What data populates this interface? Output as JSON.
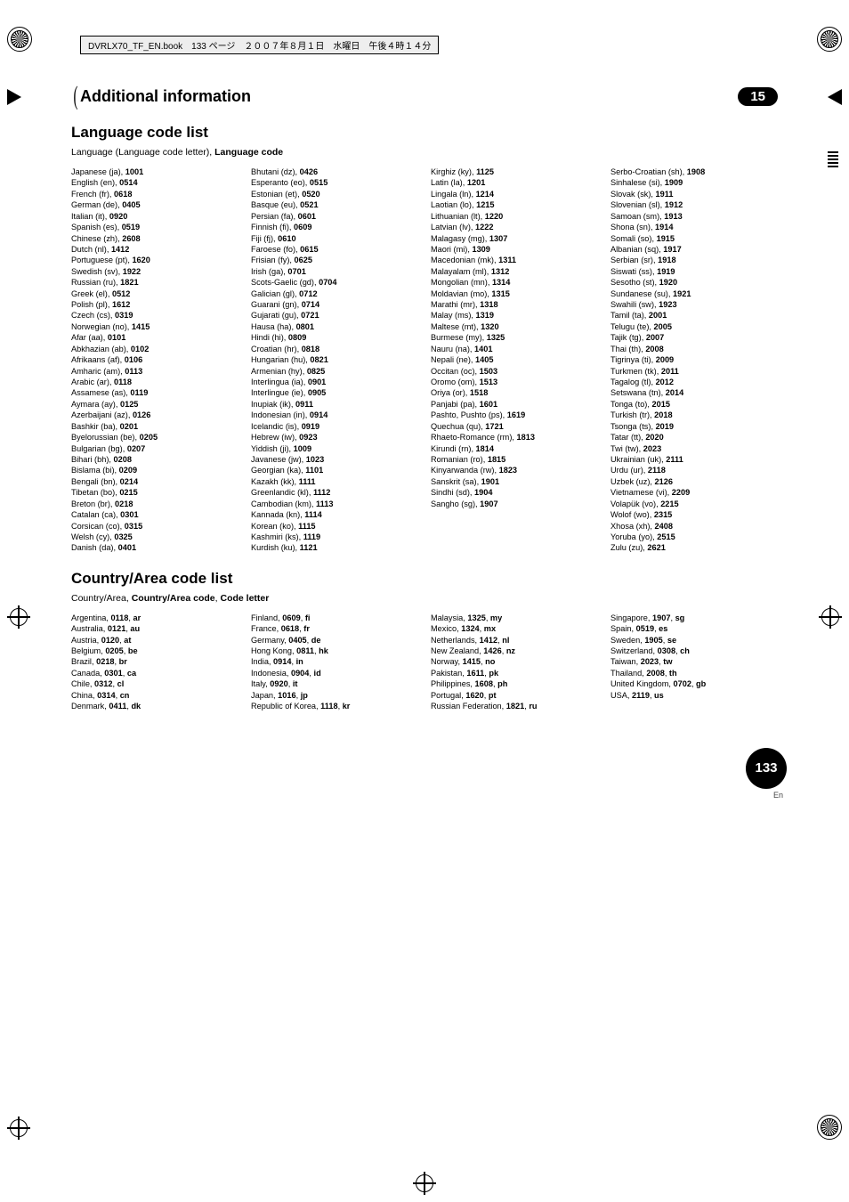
{
  "header_box": "DVRLX70_TF_EN.book　133 ページ　２００７年８月１日　水曜日　午後４時１４分",
  "section_title": "Additional information",
  "section_badge": "15",
  "lang_heading": "Language code list",
  "lang_sub_prefix": "Language (Language code letter), ",
  "lang_sub_bold": "Language code",
  "lang_cols": [
    [
      [
        "Japanese (ja), ",
        "1001"
      ],
      [
        "English (en), ",
        "0514"
      ],
      [
        "French (fr), ",
        "0618"
      ],
      [
        "German (de), ",
        "0405"
      ],
      [
        "Italian (it), ",
        "0920"
      ],
      [
        "Spanish (es), ",
        "0519"
      ],
      [
        "Chinese (zh), ",
        "2608"
      ],
      [
        "Dutch (nl), ",
        "1412"
      ],
      [
        "Portuguese (pt), ",
        "1620"
      ],
      [
        "Swedish (sv), ",
        "1922"
      ],
      [
        "Russian (ru), ",
        "1821"
      ],
      [
        "Greek (el), ",
        "0512"
      ],
      [
        "Polish (pl), ",
        "1612"
      ],
      [
        "Czech (cs), ",
        "0319"
      ],
      [
        "Norwegian (no), ",
        "1415"
      ],
      [
        "Afar (aa), ",
        "0101"
      ],
      [
        "Abkhazian (ab), ",
        "0102"
      ],
      [
        "Afrikaans (af), ",
        "0106"
      ],
      [
        "Amharic (am), ",
        "0113"
      ],
      [
        "Arabic (ar), ",
        "0118"
      ],
      [
        "Assamese (as), ",
        "0119"
      ],
      [
        "Aymara (ay), ",
        "0125"
      ],
      [
        "Azerbaijani (az), ",
        "0126"
      ],
      [
        "Bashkir (ba), ",
        "0201"
      ],
      [
        "Byelorussian (be), ",
        "0205"
      ],
      [
        "Bulgarian (bg), ",
        "0207"
      ],
      [
        "Bihari (bh), ",
        "0208"
      ],
      [
        "Bislama (bi), ",
        "0209"
      ],
      [
        "Bengali (bn), ",
        "0214"
      ],
      [
        "Tibetan (bo), ",
        "0215"
      ],
      [
        "Breton (br), ",
        "0218"
      ],
      [
        "Catalan (ca), ",
        "0301"
      ],
      [
        "Corsican (co), ",
        "0315"
      ],
      [
        "Welsh (cy), ",
        "0325"
      ],
      [
        "Danish (da), ",
        "0401"
      ]
    ],
    [
      [
        "Bhutani (dz), ",
        "0426"
      ],
      [
        "Esperanto (eo), ",
        "0515"
      ],
      [
        "Estonian (et), ",
        "0520"
      ],
      [
        "Basque (eu), ",
        "0521"
      ],
      [
        "Persian (fa), ",
        "0601"
      ],
      [
        "Finnish (fi), ",
        "0609"
      ],
      [
        "Fiji (fj), ",
        "0610"
      ],
      [
        "Faroese (fo), ",
        "0615"
      ],
      [
        "Frisian (fy), ",
        "0625"
      ],
      [
        "Irish (ga), ",
        "0701"
      ],
      [
        "Scots-Gaelic (gd), ",
        "0704"
      ],
      [
        "Galician (gl), ",
        "0712"
      ],
      [
        "Guarani (gn), ",
        "0714"
      ],
      [
        "Gujarati (gu), ",
        "0721"
      ],
      [
        "Hausa (ha), ",
        "0801"
      ],
      [
        "Hindi (hi), ",
        "0809"
      ],
      [
        "Croatian (hr), ",
        "0818"
      ],
      [
        "Hungarian (hu), ",
        "0821"
      ],
      [
        "Armenian (hy), ",
        "0825"
      ],
      [
        "Interlingua (ia), ",
        "0901"
      ],
      [
        "Interlingue (ie), ",
        "0905"
      ],
      [
        "Inupiak (ik), ",
        "0911"
      ],
      [
        "Indonesian (in), ",
        "0914"
      ],
      [
        "Icelandic (is), ",
        "0919"
      ],
      [
        "Hebrew (iw), ",
        "0923"
      ],
      [
        "Yiddish (ji), ",
        "1009"
      ],
      [
        "Javanese (jw), ",
        "1023"
      ],
      [
        "Georgian (ka), ",
        "1101"
      ],
      [
        "Kazakh (kk), ",
        "1111"
      ],
      [
        "Greenlandic (kl), ",
        "1112"
      ],
      [
        "Cambodian (km), ",
        "1113"
      ],
      [
        "Kannada (kn), ",
        "1114"
      ],
      [
        "Korean (ko), ",
        "1115"
      ],
      [
        "Kashmiri (ks), ",
        "1119"
      ],
      [
        "Kurdish (ku), ",
        "1121"
      ]
    ],
    [
      [
        "Kirghiz (ky), ",
        "1125"
      ],
      [
        "Latin (la), ",
        "1201"
      ],
      [
        "Lingala (ln), ",
        "1214"
      ],
      [
        "Laotian (lo), ",
        "1215"
      ],
      [
        "Lithuanian (lt), ",
        "1220"
      ],
      [
        "Latvian (lv), ",
        "1222"
      ],
      [
        "Malagasy (mg), ",
        "1307"
      ],
      [
        "Maori (mi), ",
        "1309"
      ],
      [
        "Macedonian (mk), ",
        "1311"
      ],
      [
        "Malayalam (ml), ",
        "1312"
      ],
      [
        "Mongolian (mn), ",
        "1314"
      ],
      [
        "Moldavian (mo), ",
        "1315"
      ],
      [
        "Marathi (mr), ",
        "1318"
      ],
      [
        "Malay (ms), ",
        "1319"
      ],
      [
        "Maltese (mt), ",
        "1320"
      ],
      [
        "Burmese (my), ",
        "1325"
      ],
      [
        "Nauru (na), ",
        "1401"
      ],
      [
        "Nepali (ne), ",
        "1405"
      ],
      [
        "Occitan (oc), ",
        "1503"
      ],
      [
        "Oromo (om), ",
        "1513"
      ],
      [
        "Oriya (or), ",
        "1518"
      ],
      [
        "Panjabi (pa), ",
        "1601"
      ],
      [
        "Pashto, Pushto (ps), ",
        "1619"
      ],
      [
        "Quechua (qu), ",
        "1721"
      ],
      [
        "Rhaeto-Romance (rm), ",
        "1813"
      ],
      [
        "Kirundi (rn), ",
        "1814"
      ],
      [
        "Romanian (ro), ",
        "1815"
      ],
      [
        "Kinyarwanda (rw), ",
        "1823"
      ],
      [
        "Sanskrit (sa), ",
        "1901"
      ],
      [
        "Sindhi (sd), ",
        "1904"
      ],
      [
        "Sangho (sg), ",
        "1907"
      ]
    ],
    [
      [
        "Serbo-Croatian (sh), ",
        "1908"
      ],
      [
        "Sinhalese (si), ",
        "1909"
      ],
      [
        "Slovak (sk), ",
        "1911"
      ],
      [
        "Slovenian (sl), ",
        "1912"
      ],
      [
        "Samoan (sm), ",
        "1913"
      ],
      [
        "Shona (sn), ",
        "1914"
      ],
      [
        "Somali (so), ",
        "1915"
      ],
      [
        "Albanian (sq), ",
        "1917"
      ],
      [
        "Serbian (sr), ",
        "1918"
      ],
      [
        "Siswati (ss), ",
        "1919"
      ],
      [
        "Sesotho (st), ",
        "1920"
      ],
      [
        "Sundanese (su), ",
        "1921"
      ],
      [
        "Swahili (sw), ",
        "1923"
      ],
      [
        "Tamil (ta), ",
        "2001"
      ],
      [
        "Telugu (te), ",
        "2005"
      ],
      [
        "Tajik (tg), ",
        "2007"
      ],
      [
        "Thai (th), ",
        "2008"
      ],
      [
        "Tigrinya (ti), ",
        "2009"
      ],
      [
        "Turkmen (tk), ",
        "2011"
      ],
      [
        "Tagalog (tl), ",
        "2012"
      ],
      [
        "Setswana (tn), ",
        "2014"
      ],
      [
        "Tonga (to), ",
        "2015"
      ],
      [
        "Turkish (tr), ",
        "2018"
      ],
      [
        "Tsonga (ts), ",
        "2019"
      ],
      [
        "Tatar (tt), ",
        "2020"
      ],
      [
        "Twi (tw), ",
        "2023"
      ],
      [
        "Ukrainian (uk), ",
        "2111"
      ],
      [
        "Urdu (ur), ",
        "2118"
      ],
      [
        "Uzbek (uz), ",
        "2126"
      ],
      [
        "Vietnamese (vi), ",
        "2209"
      ],
      [
        "Volapük (vo), ",
        "2215"
      ],
      [
        "Wolof (wo), ",
        "2315"
      ],
      [
        "Xhosa (xh), ",
        "2408"
      ],
      [
        "Yoruba (yo), ",
        "2515"
      ],
      [
        "Zulu (zu), ",
        "2621"
      ]
    ]
  ],
  "country_heading": "Country/Area code list",
  "country_sub_prefix": "Country/Area, ",
  "country_sub_bold1": "Country/Area code",
  "country_sub_sep": ", ",
  "country_sub_bold2": "Code letter",
  "country_cols": [
    [
      [
        "Argentina, ",
        "0118",
        ", ",
        "ar"
      ],
      [
        "Australia, ",
        "0121",
        ", ",
        "au"
      ],
      [
        "Austria, ",
        "0120",
        ", ",
        "at"
      ],
      [
        "Belgium, ",
        "0205",
        ", ",
        "be"
      ],
      [
        "Brazil, ",
        "0218",
        ", ",
        "br"
      ],
      [
        "Canada, ",
        "0301",
        ", ",
        "ca"
      ],
      [
        "Chile, ",
        "0312",
        ", ",
        "cl"
      ],
      [
        "China, ",
        "0314",
        ", ",
        "cn"
      ],
      [
        "Denmark, ",
        "0411",
        ", ",
        "dk"
      ]
    ],
    [
      [
        "Finland, ",
        "0609",
        ", ",
        "fi"
      ],
      [
        "France, ",
        "0618",
        ", ",
        "fr"
      ],
      [
        "Germany, ",
        "0405",
        ", ",
        "de"
      ],
      [
        "Hong Kong, ",
        "0811",
        ", ",
        "hk"
      ],
      [
        "India, ",
        "0914",
        ", ",
        "in"
      ],
      [
        "Indonesia, ",
        "0904",
        ", ",
        "id"
      ],
      [
        "Italy, ",
        "0920",
        ", ",
        "it"
      ],
      [
        "Japan, ",
        "1016",
        ", ",
        "jp"
      ],
      [
        "Republic of Korea, ",
        "1118",
        ", ",
        "kr"
      ]
    ],
    [
      [
        "Malaysia, ",
        "1325",
        ", ",
        "my"
      ],
      [
        "Mexico, ",
        "1324",
        ", ",
        "mx"
      ],
      [
        "Netherlands, ",
        "1412",
        ", ",
        "nl"
      ],
      [
        "New Zealand, ",
        "1426",
        ", ",
        "nz"
      ],
      [
        "Norway, ",
        "1415",
        ", ",
        "no"
      ],
      [
        "Pakistan, ",
        "1611",
        ", ",
        "pk"
      ],
      [
        "Philippines, ",
        "1608",
        ", ",
        "ph"
      ],
      [
        "Portugal, ",
        "1620",
        ", ",
        "pt"
      ],
      [
        "Russian Federation, ",
        "1821",
        ", ",
        "ru"
      ]
    ],
    [
      [
        "Singapore, ",
        "1907",
        ", ",
        "sg"
      ],
      [
        "Spain, ",
        "0519",
        ", ",
        "es"
      ],
      [
        "Sweden, ",
        "1905",
        ", ",
        "se"
      ],
      [
        "Switzerland, ",
        "0308",
        ", ",
        "ch"
      ],
      [
        "Taiwan, ",
        "2023",
        ", ",
        "tw"
      ],
      [
        "Thailand, ",
        "2008",
        ", ",
        "th"
      ],
      [
        "United Kingdom, ",
        "0702",
        ", ",
        "gb"
      ],
      [
        "USA, ",
        "2119",
        ", ",
        "us"
      ]
    ]
  ],
  "page_number": "133",
  "page_lang": "En"
}
